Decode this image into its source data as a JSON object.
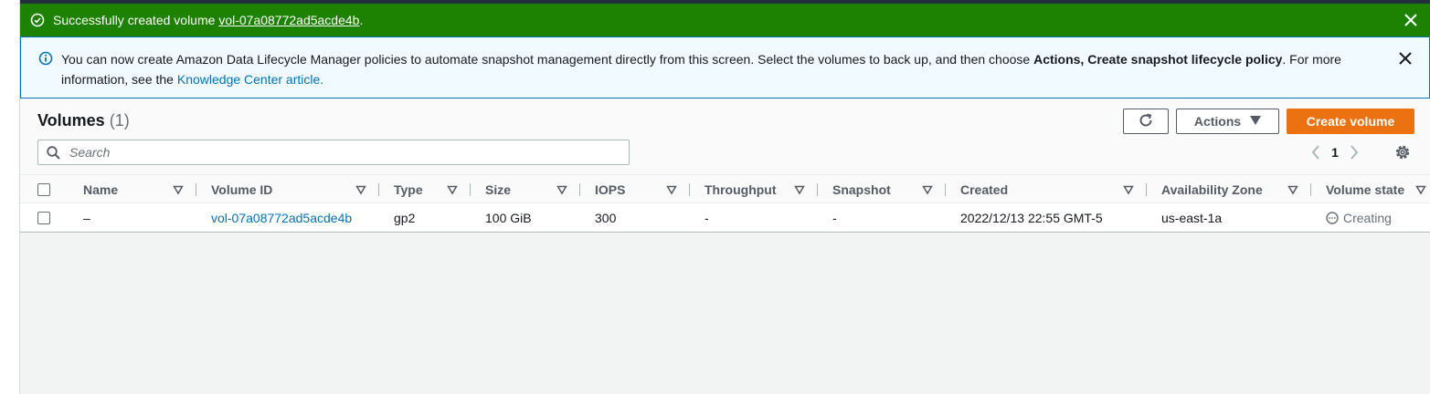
{
  "success_flash": {
    "prefix": "Successfully created volume ",
    "volume_link": "vol-07a08772ad5acde4b",
    "suffix": "."
  },
  "info_banner": {
    "text_1": "You can now create Amazon Data Lifecycle Manager policies to automate snapshot management directly from this screen. Select the volumes to back up, and then choose ",
    "bold": "Actions, Create snapshot lifecycle policy",
    "text_2": ". For more information, see the ",
    "link": "Knowledge Center article."
  },
  "panel": {
    "title": "Volumes",
    "count": "(1)",
    "actions_label": "Actions",
    "create_label": "Create volume",
    "search_placeholder": "Search",
    "page": "1"
  },
  "icons": {
    "success": "check-circle-icon",
    "info": "info-circle-icon",
    "close": "close-icon",
    "refresh": "refresh-icon",
    "caret": "caret-down-icon",
    "search": "search-icon",
    "prev": "chevron-left-icon",
    "next": "chevron-right-icon",
    "settings": "gear-icon",
    "sort": "sort-triangle-icon",
    "pending": "pending-circle-icon"
  },
  "colors": {
    "success_bg": "#1d8102",
    "info_bg": "#f1faff",
    "info_border": "#0073bb",
    "primary_button": "#ec7211",
    "link": "#0073bb"
  },
  "table": {
    "columns": [
      "Name",
      "Volume ID",
      "Type",
      "Size",
      "IOPS",
      "Throughput",
      "Snapshot",
      "Created",
      "Availability Zone",
      "Volume state"
    ],
    "rows": [
      {
        "name": "–",
        "volume_id": "vol-07a08772ad5acde4b",
        "type": "gp2",
        "size": "100 GiB",
        "iops": "300",
        "throughput": "-",
        "snapshot": "-",
        "created": "2022/12/13 22:55 GMT-5",
        "az": "us-east-1a",
        "state": "Creating"
      }
    ]
  }
}
